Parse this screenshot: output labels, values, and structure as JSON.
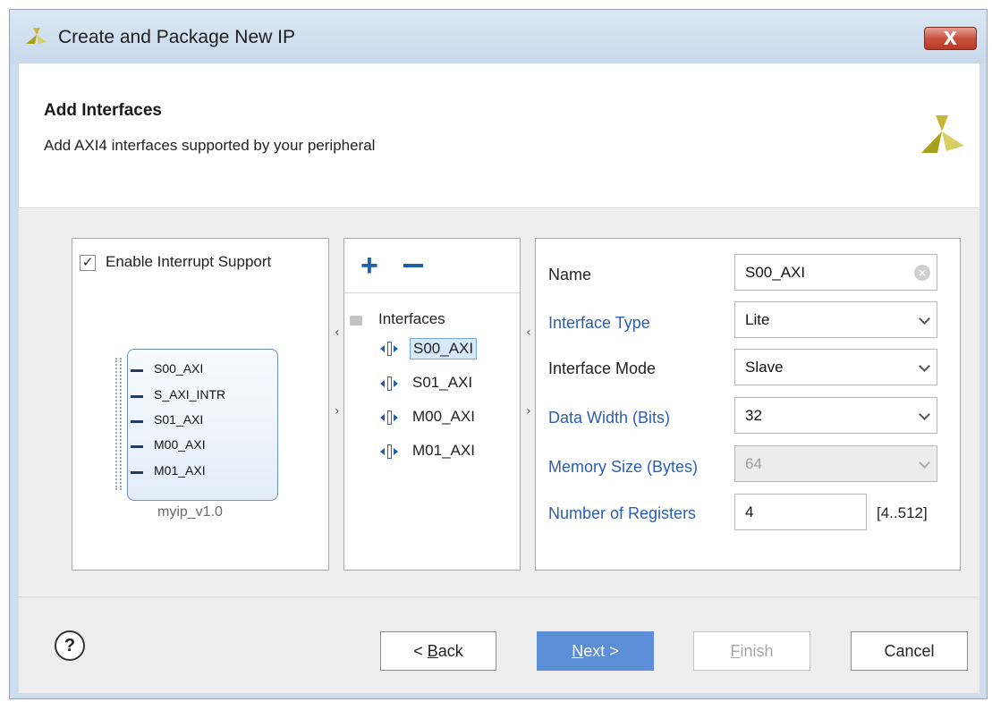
{
  "window": {
    "title": "Create and Package New IP",
    "close_label": "X"
  },
  "header": {
    "title": "Add Interfaces",
    "subtitle": "Add AXI4 interfaces supported by your peripheral"
  },
  "left_panel": {
    "checkbox_label": "Enable Interrupt Support",
    "checkbox_checked": true,
    "check_glyph": "✓",
    "ports": [
      "S00_AXI",
      "S_AXI_INTR",
      "S01_AXI",
      "M00_AXI",
      "M01_AXI"
    ],
    "ip_name": "myip_v1.0"
  },
  "splitter": {
    "left_arrow": "‹",
    "right_arrow": "›"
  },
  "middle_panel": {
    "add_label": "+",
    "root_label": "Interfaces",
    "items": [
      "S00_AXI",
      "S01_AXI",
      "M00_AXI",
      "M01_AXI"
    ],
    "selected": "S00_AXI"
  },
  "right_panel": {
    "name_label": "Name",
    "name_value": "S00_AXI",
    "clear_glyph": "×",
    "interface_type_label": "Interface Type",
    "interface_type_value": "Lite",
    "interface_mode_label": "Interface Mode",
    "interface_mode_value": "Slave",
    "data_width_label": "Data Width (Bits)",
    "data_width_value": "32",
    "memory_size_label": "Memory Size (Bytes)",
    "memory_size_value": "64",
    "num_registers_label": "Number of Registers",
    "num_registers_value": "4",
    "num_registers_range": "[4..512]"
  },
  "footer": {
    "help_glyph": "?",
    "back_prefix": "< ",
    "back_mnemonic": "B",
    "back_rest": "ack",
    "next_mnemonic": "N",
    "next_rest": "ext >",
    "finish_mnemonic": "F",
    "finish_rest": "inish",
    "cancel_label": "Cancel"
  },
  "colors": {
    "accent": "#5b8ed6",
    "label_blue": "#2a5fb0",
    "logo": "#a6a21c"
  }
}
